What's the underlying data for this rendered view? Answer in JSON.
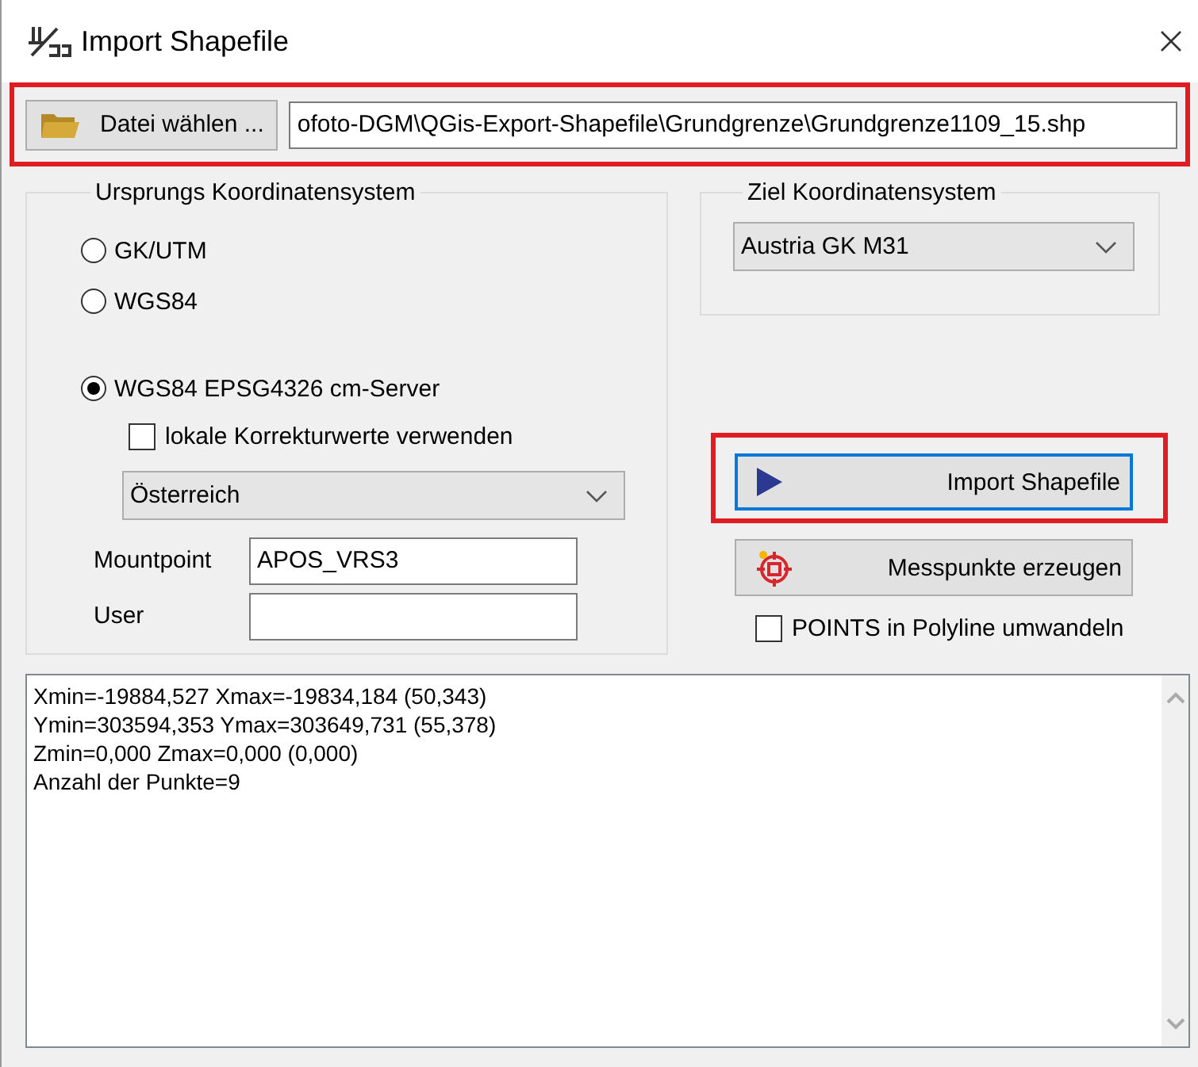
{
  "window": {
    "title": "Import Shapefile"
  },
  "file": {
    "button": "Datei wählen ...",
    "path": "ofoto-DGM\\QGis-Export-Shapefile\\Grundgrenze\\Grundgrenze1109_15.shp"
  },
  "source_crs": {
    "legend": "Ursprungs Koordinatensystem",
    "options": [
      {
        "label": "GK/UTM",
        "selected": false
      },
      {
        "label": "WGS84",
        "selected": false
      },
      {
        "label": "WGS84 EPSG4326 cm-Server",
        "selected": true
      }
    ],
    "local_corrections": {
      "label": "lokale Korrekturwerte verwenden",
      "checked": false
    },
    "region": {
      "value": "Österreich"
    },
    "mountpoint": {
      "label": "Mountpoint",
      "value": "APOS_VRS3"
    },
    "user": {
      "label": "User"
    }
  },
  "target_crs": {
    "legend": "Ziel Koordinatensystem",
    "value": "Austria GK M31"
  },
  "actions": [
    {
      "label": "Import Shapefile",
      "kind": "import",
      "focused": true
    },
    {
      "label": "Messpunkte erzeugen",
      "kind": "points",
      "focused": false
    }
  ],
  "points_to_polyline": {
    "label": "POINTS in Polyline umwandeln",
    "checked": false
  },
  "output": {
    "lines": [
      "Xmin=-19884,527 Xmax=-19834,184 (50,343)",
      "Ymin=303594,353 Ymax=303649,731 (55,378)",
      "Zmin=0,000 Zmax=0,000 (0,000)",
      "Anzahl der Punkte=9"
    ]
  }
}
